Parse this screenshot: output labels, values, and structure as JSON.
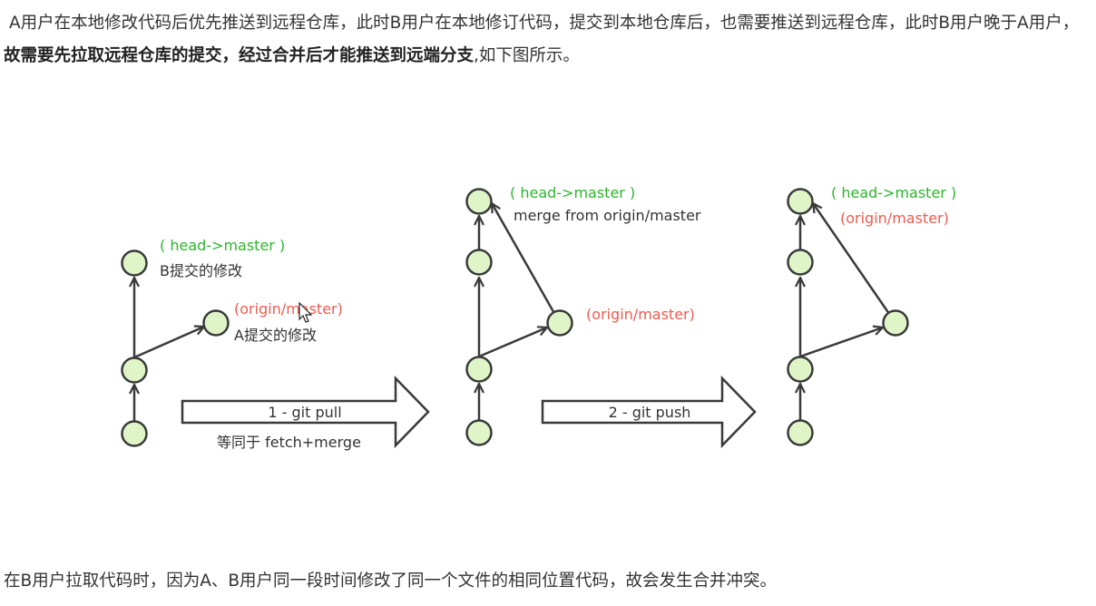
{
  "intro": {
    "text_before": "A用户在本地修改代码后优先推送到远程仓库，此时B用户在本地修订代码，提交到本地仓库后，也需要推送到远程仓库，此时B用户晚于A用户，",
    "text_bold": "故需要先拉取远程仓库的提交，经过合并后才能推送到远端分支",
    "text_after": ",如下图所示。"
  },
  "diagram": {
    "stage1": {
      "head_label": "( head->master )",
      "b_commit_label": "B提交的修改",
      "origin_label": "(origin/master)",
      "a_commit_label": "A提交的修改"
    },
    "arrow1": {
      "label": "1 - git pull",
      "sublabel": "等同于 fetch+merge"
    },
    "stage2": {
      "head_label": "( head->master )",
      "merge_label": "merge from origin/master",
      "origin_label": "(origin/master)"
    },
    "arrow2": {
      "label": "2 - git push"
    },
    "stage3": {
      "head_label": "( head->master )",
      "origin_label": "(origin/master)"
    }
  },
  "footer": {
    "text": "在B用户拉取代码时，因为A、B用户同一段时间修改了同一个文件的相同位置代码，故会发生合并冲突。"
  },
  "colors": {
    "node_fill": "#dff5c8",
    "head_label": "#2db52d",
    "origin_label": "#f05a50",
    "stroke": "#3a3a3a"
  }
}
